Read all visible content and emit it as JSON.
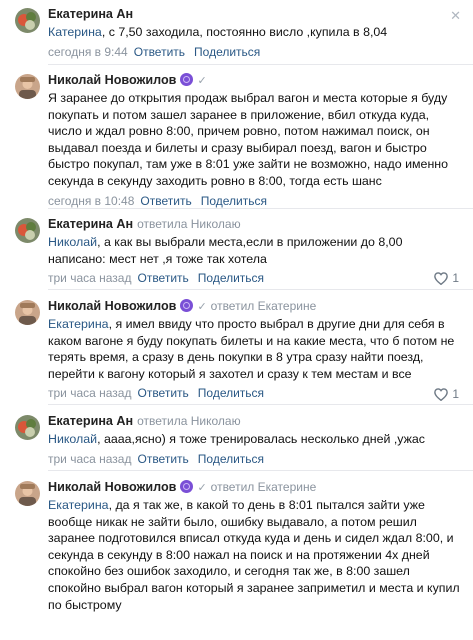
{
  "comments": [
    {
      "author": "Екатерина Ан",
      "reply_to": "",
      "mention": "Катерина",
      "text": ", с 7,50 заходила, постоянно висло ,купила в 8,04",
      "time": "сегодня в 9:44",
      "reply_label": "Ответить",
      "share_label": "Поделиться",
      "likes": ""
    },
    {
      "author": "Николай Новожилов",
      "reply_to": "",
      "mention": "",
      "text": "Я заранее до открытия продаж выбрал вагон и места которые я буду покупать и потом зашел заранее в приложение, вбил откуда куда, число и ждал ровно 8:00, причем ровно, потом нажимал поиск, он выдавал поезда и билеты и сразу выбирал поезд, вагон и быстро быстро покупал, там уже в 8:01 уже зайти не возможно, надо именно секунда в секунду заходить ровно в 8:00, тогда есть шанс",
      "time": "сегодня в 10:48",
      "reply_label": "Ответить",
      "share_label": "Поделиться",
      "likes": ""
    },
    {
      "author": "Екатерина Ан",
      "reply_to": "ответила Николаю",
      "mention": "Николай",
      "text": ", а как вы выбрали места,если в приложении до 8,00 написано: мест нет ,я тоже так хотела",
      "time": "три часа назад",
      "reply_label": "Ответить",
      "share_label": "Поделиться",
      "likes": "1"
    },
    {
      "author": "Николай Новожилов",
      "reply_to": "ответил Екатерине",
      "mention": "Екатерина",
      "text": ", я имел ввиду что просто выбрал в другие дни для себя в каком вагоне я буду покупать билеты и на какие места, что б потом не терять время, а сразу в день покупки в 8 утра сразу найти поезд, перейти к вагону который я захотел и сразу к тем местам и все",
      "time": "три часа назад",
      "reply_label": "Ответить",
      "share_label": "Поделиться",
      "likes": "1"
    },
    {
      "author": "Екатерина Ан",
      "reply_to": "ответила Николаю",
      "mention": "Николай",
      "text": ", аааа,ясно) я тоже тренировалась несколько дней ,ужас",
      "time": "три часа назад",
      "reply_label": "Ответить",
      "share_label": "Поделиться",
      "likes": ""
    },
    {
      "author": "Николай Новожилов",
      "reply_to": "ответил Екатерине",
      "mention": "Екатерина",
      "text": ", да я так же, в какой то день в 8:01 пытался зайти уже вообще никак не зайти было, ошибку выдавало, а потом решил заранее подготовился вписал откуда куда и день и сидел ждал 8:00, и секунда в секунду в 8:00 нажал на поиск и на протяжении 4х дней спокойно без ошибок заходило, и сегодня так же, в 8:00 зашел спокойно выбрал вагон который я заранее заприметил и места и купил по быстрому",
      "time": "",
      "reply_label": "",
      "share_label": "",
      "likes": ""
    }
  ],
  "icons": {
    "more": "close-x-icon",
    "like": "heart-icon",
    "verified": "verified-badge-icon",
    "check": "checkmark-icon"
  },
  "colors": {
    "link": "#2a5885",
    "muted": "#8a939e",
    "badge": "#7a4fd6"
  }
}
